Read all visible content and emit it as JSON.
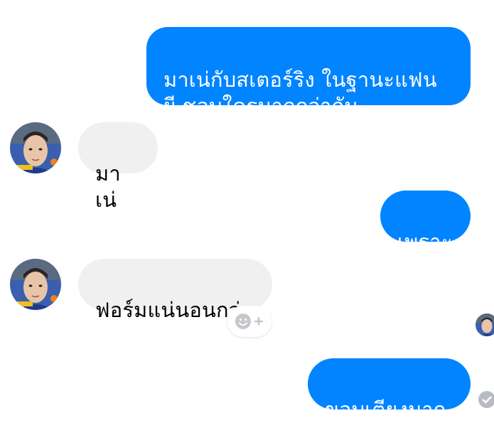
{
  "messages": [
    {
      "direction": "outgoing",
      "text": "มาเน่กับสเตอร์ริง ในฐานะแฟน\nผี ชอบใครมากกว่ากัน"
    },
    {
      "direction": "incoming",
      "text": "มาเน่"
    },
    {
      "direction": "outgoing",
      "text": "เพราะ"
    },
    {
      "direction": "incoming",
      "text": "ฟอร์มแน่นอนกว่า"
    },
    {
      "direction": "outgoing",
      "text": "ขอบเตียงมาก"
    }
  ],
  "icons": {
    "contact_avatar": "avatar-icon",
    "reaction": "smiley-plus-icon",
    "read_receipt": "seen-avatar-icon",
    "delivered": "check-circle-icon"
  },
  "colors": {
    "outgoing_bubble": "#0084ff",
    "incoming_bubble": "#f1f0f0",
    "outgoing_text": "#ffffff",
    "incoming_text": "#000000"
  }
}
